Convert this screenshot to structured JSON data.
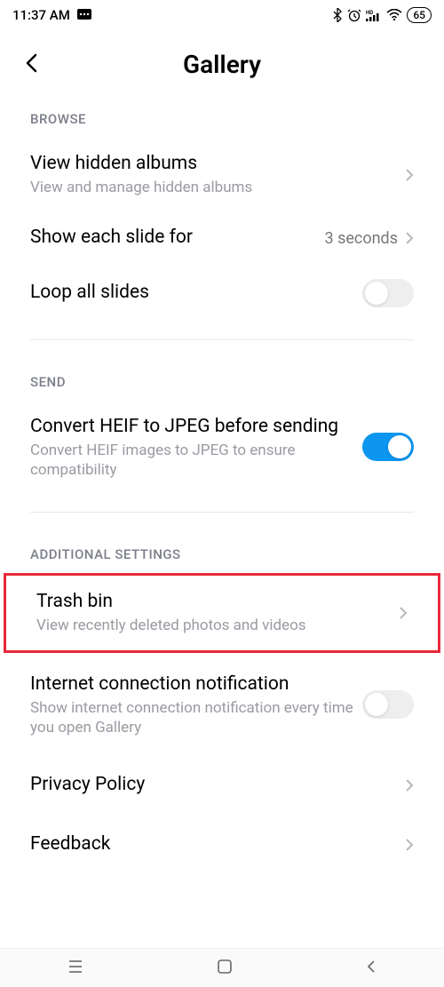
{
  "status": {
    "time": "11:37 AM",
    "battery": "65"
  },
  "header": {
    "title": "Gallery"
  },
  "sections": {
    "browse": {
      "label": "BROWSE",
      "items": {
        "hidden_albums": {
          "title": "View hidden albums",
          "subtitle": "View and manage hidden albums"
        },
        "slide_duration": {
          "title": "Show each slide for",
          "value": "3 seconds"
        },
        "loop_slides": {
          "title": "Loop all slides"
        }
      }
    },
    "send": {
      "label": "SEND",
      "items": {
        "convert_heif": {
          "title": "Convert HEIF to JPEG before sending",
          "subtitle": "Convert HEIF images to JPEG to ensure compatibility"
        }
      }
    },
    "additional": {
      "label": "ADDITIONAL SETTINGS",
      "items": {
        "trash_bin": {
          "title": "Trash bin",
          "subtitle": "View recently deleted photos and videos"
        },
        "internet_notif": {
          "title": "Internet connection notification",
          "subtitle": "Show internet connection notification every time you open Gallery"
        },
        "privacy": {
          "title": "Privacy Policy"
        },
        "feedback": {
          "title": "Feedback"
        }
      }
    }
  }
}
